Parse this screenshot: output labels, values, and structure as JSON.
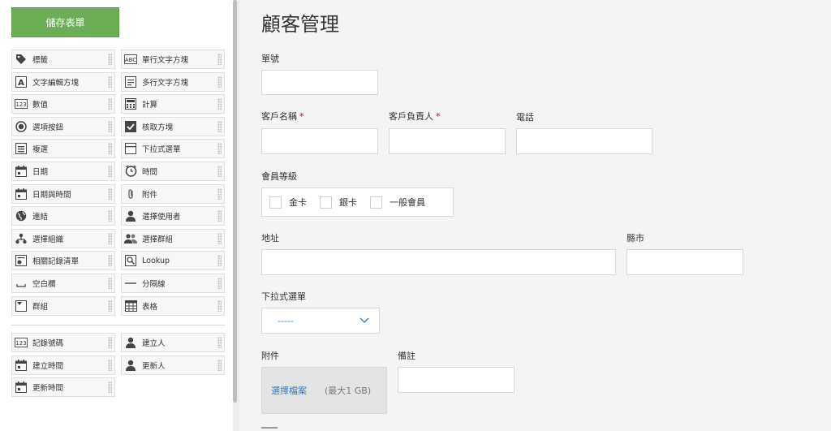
{
  "toolbar": {
    "save_label": "儲存表單"
  },
  "palette_main": [
    {
      "label": "標籤",
      "icon": "tag-icon"
    },
    {
      "label": "單行文字方塊",
      "icon": "abc-textbox-icon"
    },
    {
      "label": "文字編輯方塊",
      "icon": "rich-text-icon"
    },
    {
      "label": "多行文字方塊",
      "icon": "multiline-text-icon"
    },
    {
      "label": "數值",
      "icon": "number-icon"
    },
    {
      "label": "計算",
      "icon": "calculator-icon"
    },
    {
      "label": "選項按鈕",
      "icon": "radio-button-icon"
    },
    {
      "label": "核取方塊",
      "icon": "checkbox-icon"
    },
    {
      "label": "複選",
      "icon": "multi-select-icon"
    },
    {
      "label": "下拉式選單",
      "icon": "dropdown-icon"
    },
    {
      "label": "日期",
      "icon": "calendar-icon"
    },
    {
      "label": "時間",
      "icon": "clock-icon"
    },
    {
      "label": "日期與時間",
      "icon": "calendar-clock-icon"
    },
    {
      "label": "附件",
      "icon": "paperclip-icon"
    },
    {
      "label": "連結",
      "icon": "globe-icon"
    },
    {
      "label": "選擇使用者",
      "icon": "user-icon"
    },
    {
      "label": "選擇組織",
      "icon": "org-icon"
    },
    {
      "label": "選擇群組",
      "icon": "group-icon"
    },
    {
      "label": "相關記錄清單",
      "icon": "related-records-icon"
    },
    {
      "label": "Lookup",
      "icon": "lookup-icon"
    },
    {
      "label": "空白欄",
      "icon": "blank-space-icon"
    },
    {
      "label": "分隔線",
      "icon": "divider-line-icon"
    },
    {
      "label": "群組",
      "icon": "group-field-icon"
    },
    {
      "label": "表格",
      "icon": "table-icon"
    }
  ],
  "palette_system": [
    {
      "label": "記錄號碼",
      "icon": "record-number-icon"
    },
    {
      "label": "建立人",
      "icon": "user-icon"
    },
    {
      "label": "建立時間",
      "icon": "calendar-icon"
    },
    {
      "label": "更新人",
      "icon": "user-icon"
    },
    {
      "label": "更新時間",
      "icon": "calendar-icon"
    }
  ],
  "form": {
    "title": "顧客管理",
    "record_no_label": "單號",
    "customer_name_label": "客戶名稱",
    "contact_person_label": "客戶負責人",
    "phone_label": "電話",
    "required_mark": "*",
    "membership_label": "會員等級",
    "membership_options": [
      "金卡",
      "銀卡",
      "一般會員"
    ],
    "address_label": "地址",
    "city_label": "縣市",
    "dropdown_label": "下拉式選單",
    "dropdown_value": "-----",
    "attachment_label": "附件",
    "attachment_button": "選擇檔案",
    "attachment_limit": "(最大1 GB)",
    "notes_label": "備註"
  },
  "colors": {
    "save_button": "#6cae55",
    "required": "#d0021b",
    "link": "#3a7bbf"
  }
}
